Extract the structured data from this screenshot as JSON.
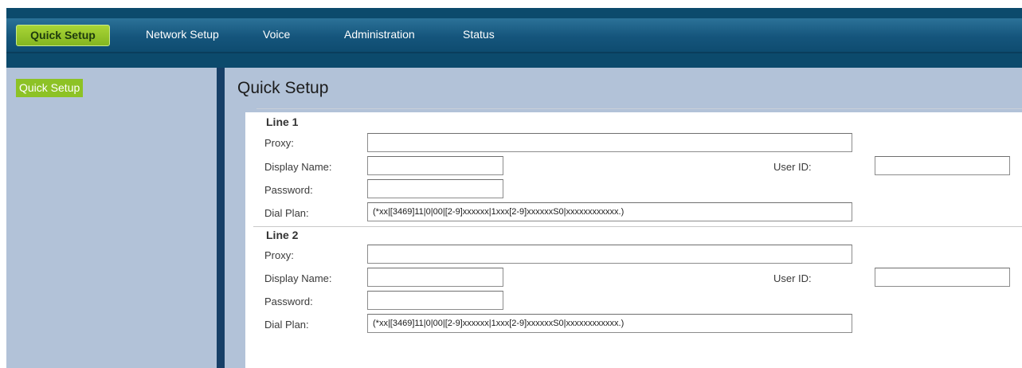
{
  "nav": {
    "items": [
      "Quick Setup",
      "Network Setup",
      "Voice",
      "Administration",
      "Status"
    ],
    "active": "Quick Setup"
  },
  "sidebar": {
    "items": [
      "Quick Setup"
    ]
  },
  "page": {
    "title": "Quick Setup"
  },
  "lines": [
    {
      "heading": "Line 1",
      "proxy_label": "Proxy:",
      "proxy_value": "",
      "display_name_label": "Display Name:",
      "display_name_value": "",
      "user_id_label": "User ID:",
      "user_id_value": "",
      "password_label": "Password:",
      "password_value": "",
      "dial_plan_label": "Dial Plan:",
      "dial_plan_value": "(*xx|[3469]11|0|00|[2-9]xxxxxx|1xxx[2-9]xxxxxxS0|xxxxxxxxxxxx.)"
    },
    {
      "heading": "Line 2",
      "proxy_label": "Proxy:",
      "proxy_value": "",
      "display_name_label": "Display Name:",
      "display_name_value": "",
      "user_id_label": "User ID:",
      "user_id_value": "",
      "password_label": "Password:",
      "password_value": "",
      "dial_plan_label": "Dial Plan:",
      "dial_plan_value": "(*xx|[3469]11|0|00|[2-9]xxxxxx|1xxx[2-9]xxxxxxS0|xxxxxxxxxxxx.)"
    }
  ],
  "colors": {
    "nav_active": "#8dc225",
    "header": "#15557c",
    "sidebar_bg": "#b2c2d8",
    "divider": "#173f67"
  }
}
